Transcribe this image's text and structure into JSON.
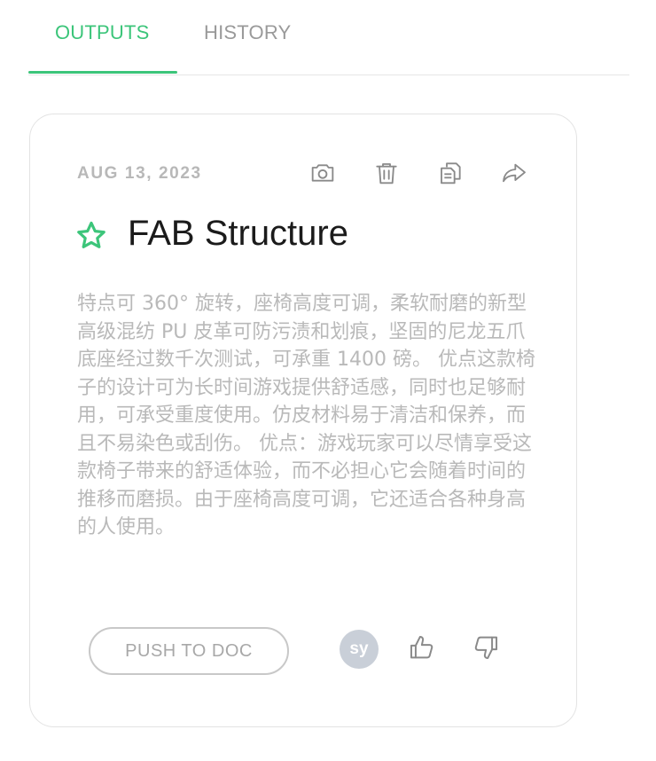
{
  "tabs": {
    "outputs_label": "OUTPUTS",
    "history_label": "HISTORY",
    "active": "OUTPUTS"
  },
  "card": {
    "date": "AUG 13, 2023",
    "title": "FAB Structure",
    "description": "特点可 360° 旋转，座椅高度可调，柔软耐磨的新型高级混纺 PU 皮革可防污渍和划痕，坚固的尼龙五爪底座经过数千次测试，可承重 1400 磅。 优点这款椅子的设计可为长时间游戏提供舒适感，同时也足够耐用，可承受重度使用。仿皮材料易于清洁和保养，而且不易染色或刮伤。 优点：游戏玩家可以尽情享受这款椅子带来的舒适体验，而不必担心它会随着时间的推移而磨损。由于座椅高度可调，它还适合各种身高的人使用。",
    "push_button_label": "PUSH TO DOC",
    "avatar_initials": "sy",
    "icons": [
      "camera-icon",
      "trash-icon",
      "copy-icon",
      "share-icon",
      "star-icon",
      "thumbs-up-icon",
      "thumbs-down-icon"
    ]
  },
  "colors": {
    "accent": "#3cc57a",
    "muted_text": "#b9b9b9",
    "icon_gray": "#8a8a8a",
    "avatar_bg": "#c9cfd8"
  }
}
